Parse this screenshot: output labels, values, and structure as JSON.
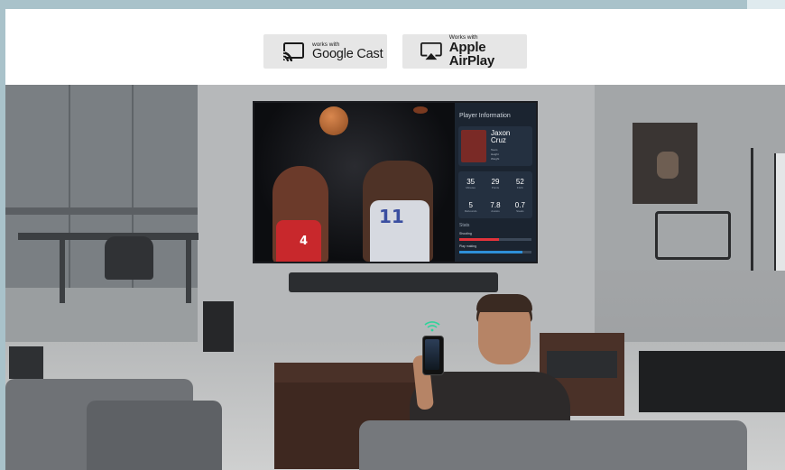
{
  "badges": {
    "google_cast": {
      "small": "works with",
      "big": "Google Cast"
    },
    "airplay": {
      "small": "Works with",
      "big": "Apple AirPlay"
    }
  },
  "tv": {
    "game": {
      "jersey_left": "4",
      "jersey_right": "11"
    },
    "panel": {
      "status_left": "",
      "status_right": "",
      "title": "Player Information",
      "player_name_first": "Jaxon",
      "player_name_last": "Cruz",
      "meta": [
        {
          "label": "Team",
          "value": ""
        },
        {
          "label": "Height",
          "value": ""
        },
        {
          "label": "Weight",
          "value": ""
        }
      ],
      "stats": [
        {
          "value": "35",
          "label": "Minutes"
        },
        {
          "value": "29",
          "label": "Points"
        },
        {
          "value": "52",
          "label": "FG%"
        },
        {
          "value": "5",
          "label": "Rebounds"
        },
        {
          "value": "7.8",
          "label": "Assists"
        },
        {
          "value": "0.7",
          "label": "Steals"
        }
      ],
      "stats_title": "Stats",
      "bars": [
        {
          "label": "Shooting",
          "value": 0.55,
          "color": "#e2333b"
        },
        {
          "label": "Play making",
          "value": 0.88,
          "color": "#2e8fd8"
        }
      ]
    }
  },
  "colors": {
    "frame": "#a9c2ca",
    "badge_bg": "#e6e6e6",
    "panel_bg": "#1b2430"
  }
}
